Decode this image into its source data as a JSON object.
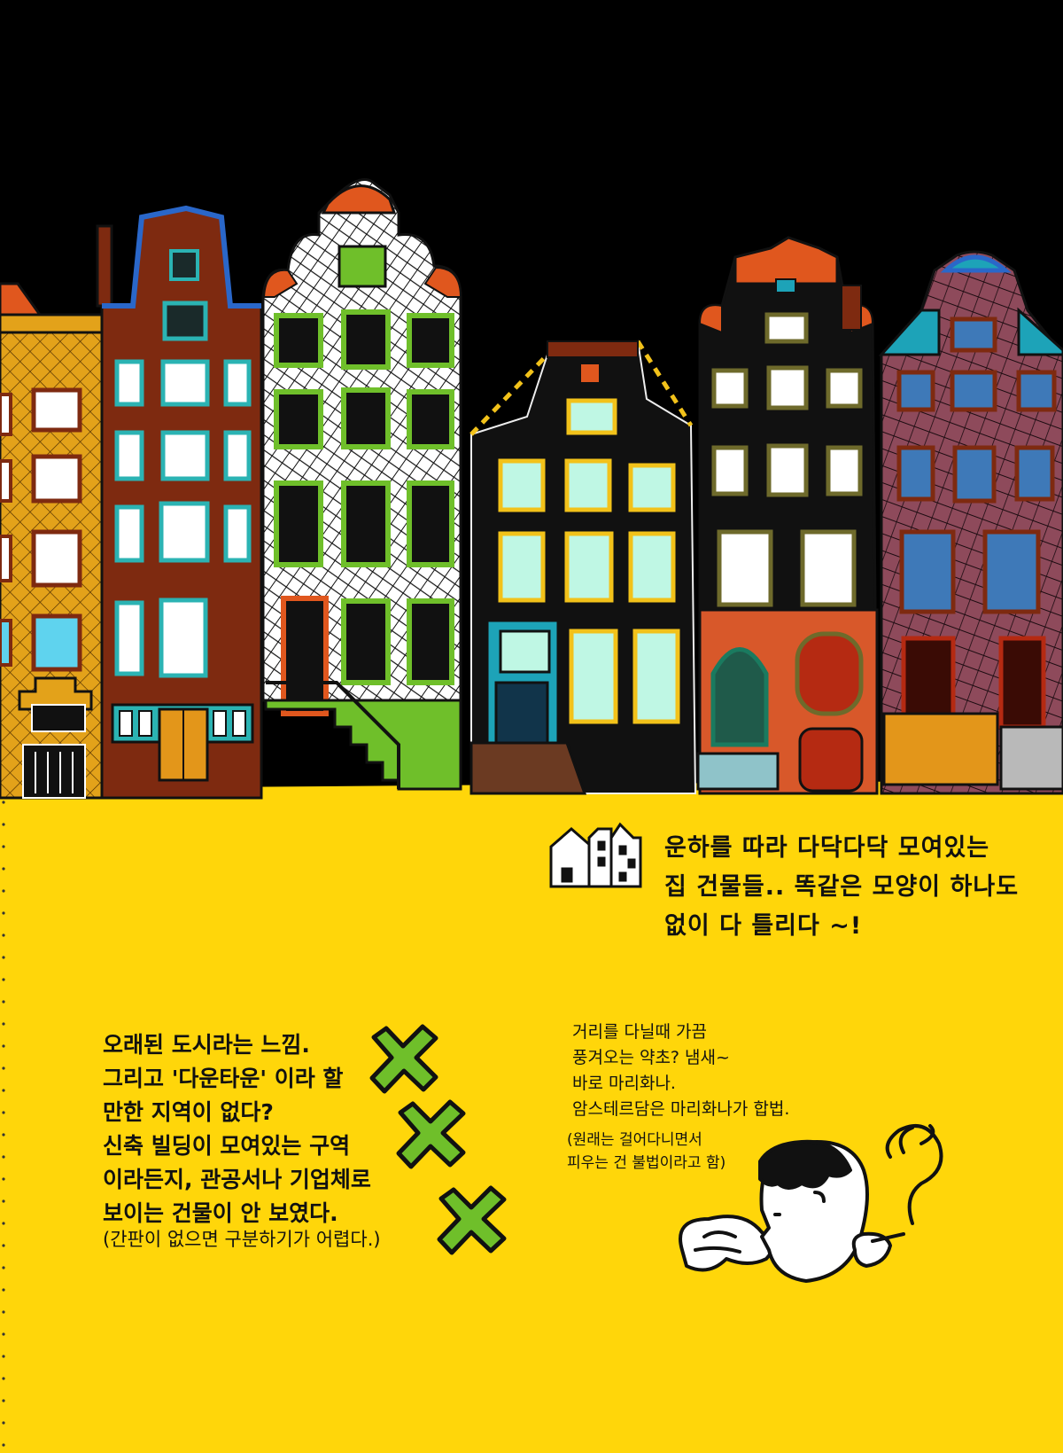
{
  "colors": {
    "sky": "#000000",
    "ground": "#FFD60A",
    "brick_red": "#7E2A10",
    "orange_tile": "#E0571E",
    "green_window": "#6FBF2A",
    "mint_window": "#BFF7E4",
    "blue_window": "#3E79B8",
    "teal_accent": "#1DA3B8",
    "ochre": "#E3A21A",
    "mauve": "#8E4A5B",
    "dark_olive": "#6E6A2B"
  },
  "texts": {
    "canal_houses": "운하를 따라 다닥다닥 모여있는\n집 건물들.. 똑같은 모양이 하나도\n없이 다 틀리다 ~!",
    "old_city": "오래된 도시라는 느낌.\n그리고 '다운타운' 이라 할\n만한 지역이 없다?\n신축 빌딩이 모여있는 구역\n이라든지, 관공서나 기업체로\n보이는 건물이 안 보였다.",
    "old_city_note": "(간판이 없으면 구분하기가 어렵다.)",
    "street_smell": "거리를 다닐때 가끔\n풍겨오는 약초? 냄새~\n바로 마리화나.\n암스테르담은 마리화나가 합법.",
    "street_smell_note": "(원래는 걸어다니면서\n피우는 건 불법이라고 함)"
  },
  "icons": {
    "small_houses": "small-houses-icon",
    "cross_marks": "green-x-icon",
    "smoking_boy": "smoking-boy-illustration"
  }
}
